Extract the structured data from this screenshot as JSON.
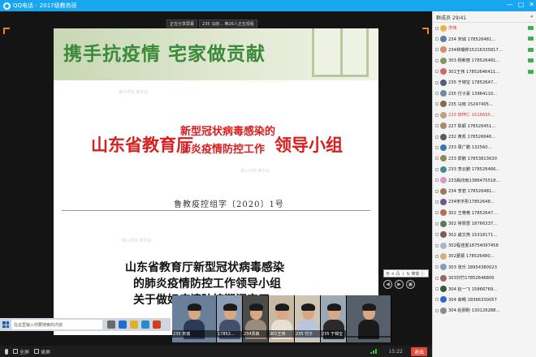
{
  "window": {
    "app_name": "QQ电话 -",
    "group_name": "2017级教务班",
    "controls": [
      "—",
      "□",
      "✕"
    ]
  },
  "share_bar": {
    "items": [
      "正在分享屏幕",
      "235 马晓... 等26人正在观看"
    ]
  },
  "slide": {
    "banner": "携手抗疫情  宅家做贡献",
    "watermark": "泰山学院 教务处",
    "red_title_left": "山东省教育厅",
    "red_title_mid1": "新型冠状病毒感染的",
    "red_title_mid2": "肺炎疫情防控工作",
    "red_title_right": "领导小组",
    "doc_number": "鲁教疫控组字〔2020〕1号",
    "lines": [
      "山东省教育厅新型冠状病毒感染",
      "的肺炎疫情防控工作领导小组",
      "关于做好疫情防控期间实习",
      "实..."
    ]
  },
  "slide_control": {
    "label": "示 ≎ 凸 丨 ⇅ 简体 ⓘ",
    "buttons": [
      "◀",
      "▶",
      "▣"
    ]
  },
  "win_taskbar": {
    "search_placeholder": "在这里输入你要搜索的内容"
  },
  "videos": [
    {
      "name": "235 宋城",
      "bg": "#6a7f9a",
      "body": "#2b3b55"
    },
    {
      "name": "17852...",
      "bg": "#8c9db4",
      "body": "#44506a"
    },
    {
      "name": "234贾森",
      "bg": "#4b4b4b",
      "body": "#9b8b7b"
    },
    {
      "name": "301王伟",
      "bg": "#c7b9a2",
      "body": "#e8e0d3"
    },
    {
      "name": "235 付子",
      "bg": "#cfc7b4",
      "body": "#b8c6dc"
    },
    {
      "name": "235 于锦宝",
      "bg": "#9aa9b5",
      "body": "#2a2a2a"
    },
    {
      "name": "",
      "bg": "#55606b",
      "body": "#1a1a1a"
    }
  ],
  "bottom_bar": {
    "items": [
      "全屏",
      "录屏"
    ],
    "time": "15:22",
    "exit_label": "退出"
  },
  "panel": {
    "title": "群成员 29/41",
    "minimize": "◂",
    "members": [
      {
        "name": "洪伟",
        "av": "#e6b34a",
        "type": "host",
        "status": "on"
      },
      {
        "name": "234 宋城  178526481...",
        "av": "#5a7fa8",
        "type": "",
        "status": "on"
      },
      {
        "name": "234林璐婷15216335817...",
        "av": "#d88c6a",
        "type": "",
        "status": "on"
      },
      {
        "name": "303 杨新丽  178526481...",
        "av": "#7a9b5e",
        "type": "",
        "status": "on"
      },
      {
        "name": "301王伟 17852646411...",
        "av": "#c96a6a",
        "type": "",
        "status": "on"
      },
      {
        "name": "235 于锦宝  17852647...",
        "av": "#4f5f7a",
        "type": "",
        "status": "off"
      },
      {
        "name": "235 付子豪 13964110...",
        "av": "#6a8ca8",
        "type": "",
        "status": "off"
      },
      {
        "name": "235 马晓  15247405...",
        "av": "#8a6a4a",
        "type": "",
        "status": "off"
      },
      {
        "name": "233 田梓仁 1516695...",
        "av": "#c0a080",
        "type": "red",
        "status": "off"
      },
      {
        "name": "227 陈颖  178526451...",
        "av": "#a88a6a",
        "type": "",
        "status": "off"
      },
      {
        "name": "232 黄凯  178526646...",
        "av": "#5a5a5a",
        "type": "",
        "status": "off"
      },
      {
        "name": "233 周广鹏 132560...",
        "av": "#3a7ab0",
        "type": "",
        "status": "off"
      },
      {
        "name": "233 郭鹏  17853813630",
        "av": "#8a8a5a",
        "type": "",
        "status": "off"
      },
      {
        "name": "233 李云鹏  178526466...",
        "av": "#4a8a8a",
        "type": "",
        "status": "off"
      },
      {
        "name": "233高欣雨1386475518...",
        "av": "#d0a0c0",
        "type": "",
        "status": "off"
      },
      {
        "name": "234 李若  178526481...",
        "av": "#9a7a5a",
        "type": "",
        "status": "off"
      },
      {
        "name": "234宋宇彤17852648...",
        "av": "#6a5a8a",
        "type": "",
        "status": "off"
      },
      {
        "name": "302 王艳艳  17852647...",
        "av": "#b07050",
        "type": "",
        "status": "off"
      },
      {
        "name": "302 常佩雪 18766337...",
        "av": "#5a7a5a",
        "type": "",
        "status": "off"
      },
      {
        "name": "302 戚文燕 15318171...",
        "av": "#7a5a5a",
        "type": "",
        "status": "off"
      },
      {
        "name": "302程佳雯18754097458",
        "av": "#b0b0d0",
        "type": "",
        "status": "off"
      },
      {
        "name": "302夏颖 178526480...",
        "av": "#d0b080",
        "type": "",
        "status": "off"
      },
      {
        "name": "303 张乐 18954380023",
        "av": "#80a0c0",
        "type": "",
        "status": "off"
      },
      {
        "name": "303刘竹17852646800",
        "av": "#a06060",
        "type": "",
        "status": "off"
      },
      {
        "name": "304 赵一飞 15866769...",
        "av": "#3a5a3a",
        "type": "",
        "status": "off"
      },
      {
        "name": "304 高畅 18366330057",
        "av": "#2a6ad0",
        "type": "",
        "status": "off"
      },
      {
        "name": "304 赵朋盼 130126288...",
        "av": "#8a8a8a",
        "type": "",
        "status": "off"
      }
    ]
  }
}
